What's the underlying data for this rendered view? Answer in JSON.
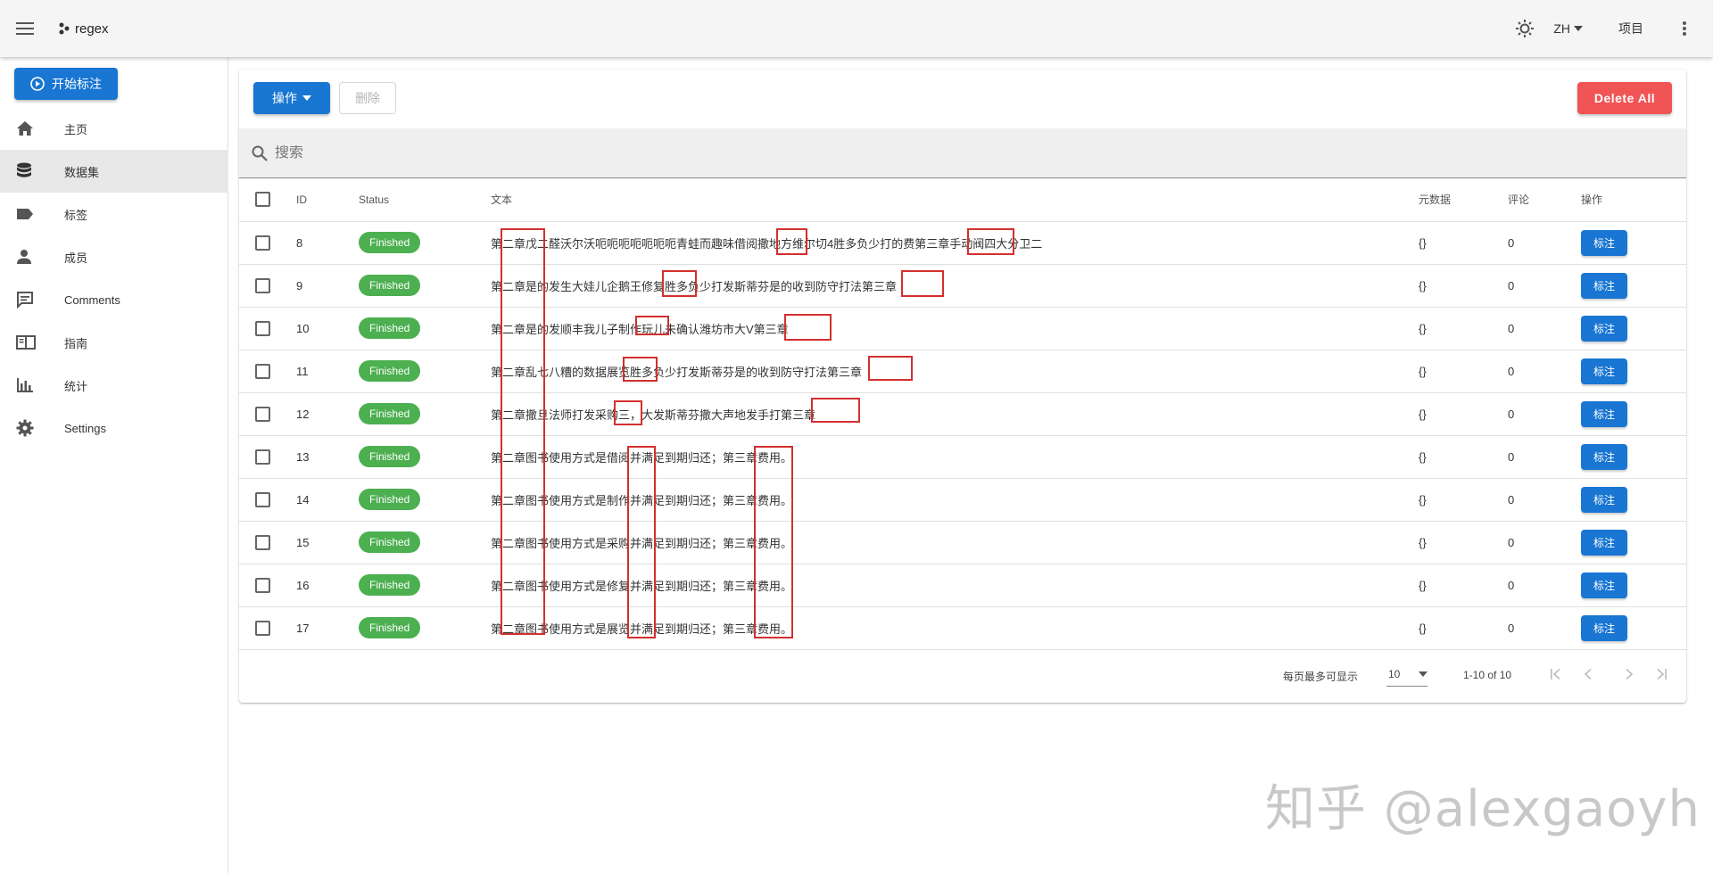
{
  "appbar": {
    "logo_text": "regex",
    "language": "ZH",
    "projects_label": "项目"
  },
  "sidebar": {
    "start_button": "开始标注",
    "items": [
      {
        "label": "主页",
        "icon": "home-icon"
      },
      {
        "label": "数据集",
        "icon": "database-icon"
      },
      {
        "label": "标签",
        "icon": "label-icon"
      },
      {
        "label": "成员",
        "icon": "person-icon"
      },
      {
        "label": "Comments",
        "icon": "comment-icon"
      },
      {
        "label": "指南",
        "icon": "book-icon"
      },
      {
        "label": "统计",
        "icon": "chart-icon"
      },
      {
        "label": "Settings",
        "icon": "gear-icon"
      }
    ],
    "active_index": 1
  },
  "toolbar": {
    "actions_label": "操作",
    "delete_label": "删除",
    "delete_all_label": "Delete All"
  },
  "search": {
    "placeholder": "搜索"
  },
  "table": {
    "headers": {
      "id": "ID",
      "status": "Status",
      "text": "文本",
      "meta": "元数据",
      "comments": "评论",
      "actions": "操作"
    },
    "rows": [
      {
        "id": "8",
        "status": "Finished",
        "text": "第二章戊二醛沃尔沃呃呃呃呃呃呃呃青蛙而趣味借阅撒地方维尔切4胜多负少打的费第三章手动阀四大分卫二",
        "meta": "{}",
        "comments": "0",
        "action": "标注"
      },
      {
        "id": "9",
        "status": "Finished",
        "text": "第二章是的发生大娃儿企鹅王修复胜多负少打发斯蒂芬是的收到防守打法第三章",
        "meta": "{}",
        "comments": "0",
        "action": "标注"
      },
      {
        "id": "10",
        "status": "Finished",
        "text": "第二章是的发顺丰我儿子制作玩儿未确认潍坊市大V第三章",
        "meta": "{}",
        "comments": "0",
        "action": "标注"
      },
      {
        "id": "11",
        "status": "Finished",
        "text": "第二章乱七八糟的数据展览胜多负少打发斯蒂芬是的收到防守打法第三章",
        "meta": "{}",
        "comments": "0",
        "action": "标注"
      },
      {
        "id": "12",
        "status": "Finished",
        "text": "第二章撒旦法师打发采购三，大发斯蒂芬撒大声地发手打第三章",
        "meta": "{}",
        "comments": "0",
        "action": "标注"
      },
      {
        "id": "13",
        "status": "Finished",
        "text": "第二章图书使用方式是借阅并满足到期归还；第三章费用。",
        "meta": "{}",
        "comments": "0",
        "action": "标注"
      },
      {
        "id": "14",
        "status": "Finished",
        "text": "第二章图书使用方式是制作并满足到期归还；第三章费用。",
        "meta": "{}",
        "comments": "0",
        "action": "标注"
      },
      {
        "id": "15",
        "status": "Finished",
        "text": "第二章图书使用方式是采购并满足到期归还；第三章费用。",
        "meta": "{}",
        "comments": "0",
        "action": "标注"
      },
      {
        "id": "16",
        "status": "Finished",
        "text": "第二章图书使用方式是修复并满足到期归还；第三章费用。",
        "meta": "{}",
        "comments": "0",
        "action": "标注"
      },
      {
        "id": "17",
        "status": "Finished",
        "text": "第二章图书使用方式是展览并满足到期归还；第三章费用。",
        "meta": "{}",
        "comments": "0",
        "action": "标注"
      }
    ]
  },
  "pagination": {
    "rows_per_page_label": "每页最多可显示",
    "rows_per_page": "10",
    "range": "1-10 of 10"
  },
  "watermark": "知乎 @alexgaoyh",
  "colors": {
    "primary": "#1976d2",
    "danger": "#f05454",
    "success": "#4caf50",
    "annotation": "#d32f2f"
  }
}
